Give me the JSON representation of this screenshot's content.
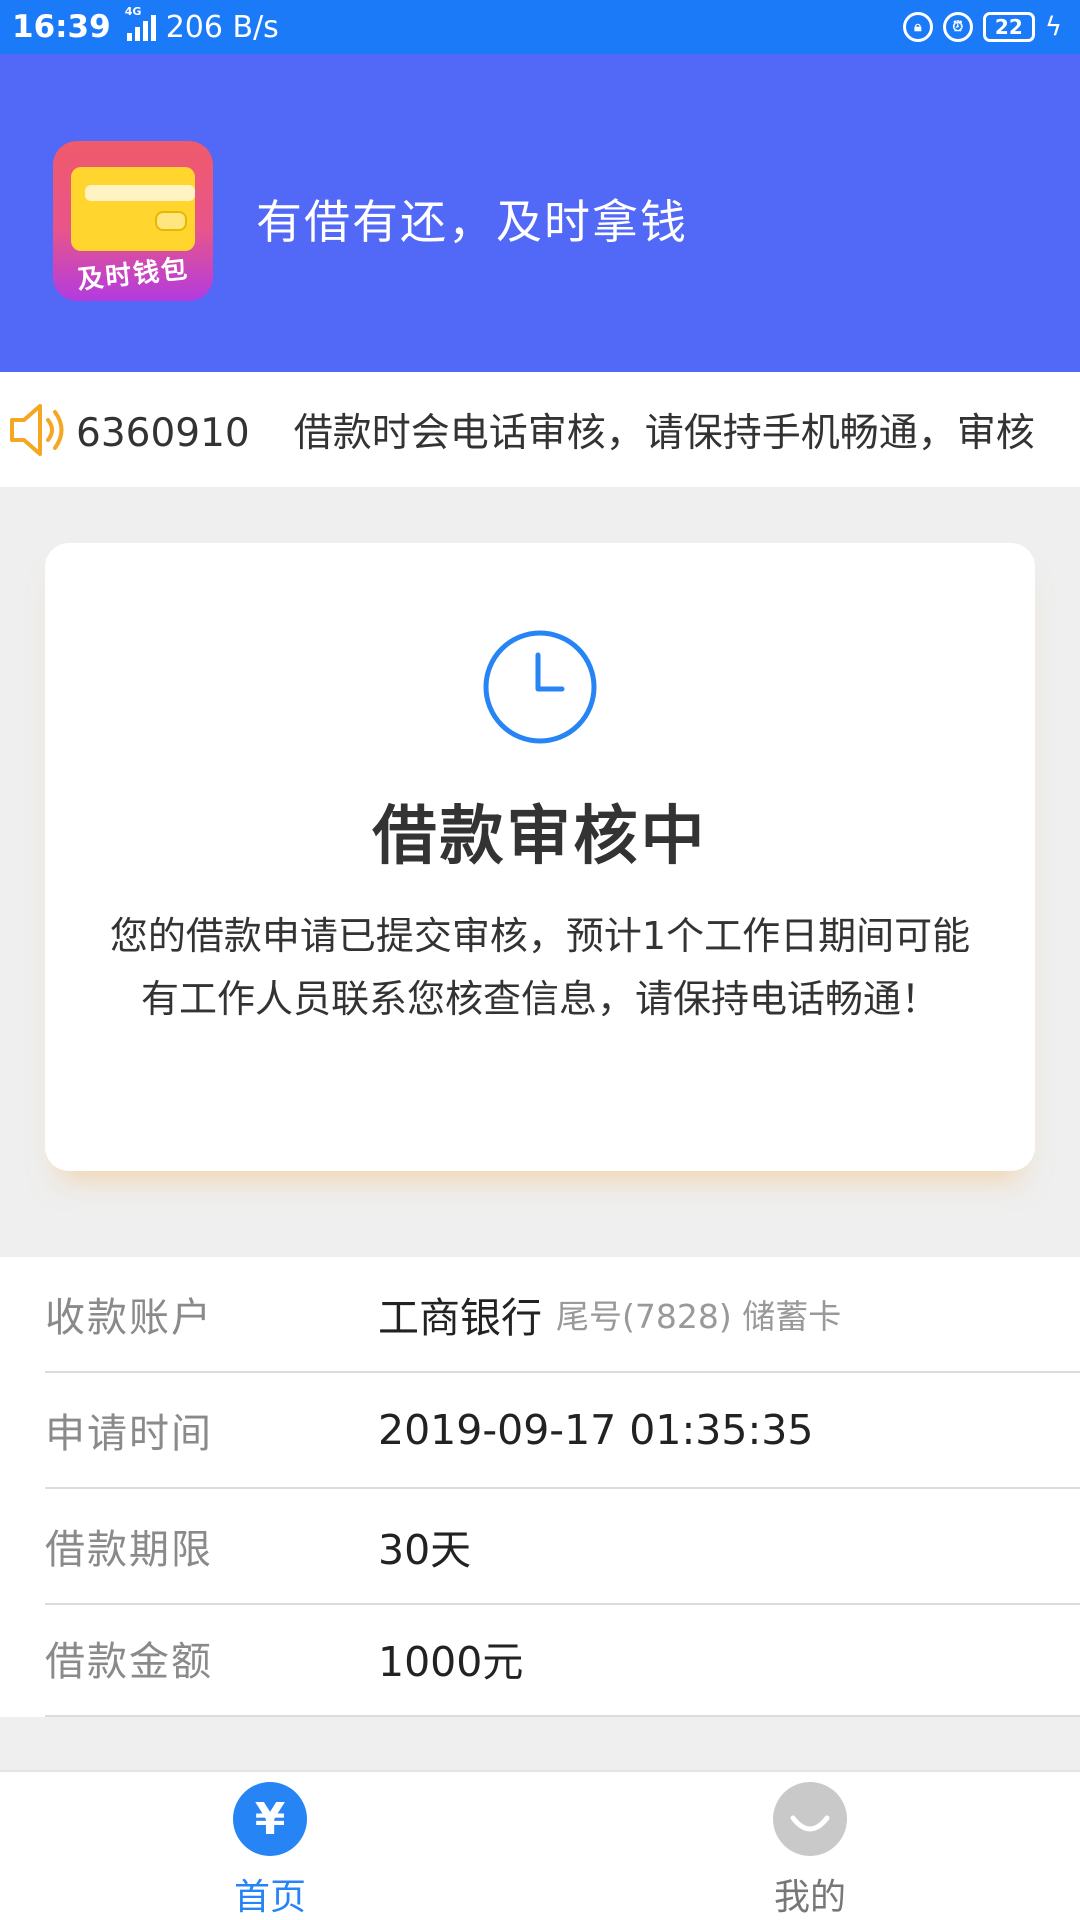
{
  "status_bar": {
    "time": "16:39",
    "network_type": "4G",
    "net_speed": "206 B/s",
    "battery": "22"
  },
  "header": {
    "logo_text": "及时钱包",
    "slogan": "有借有还，及时拿钱"
  },
  "notice": {
    "text_prefix": "6360910",
    "text_main": "借款时会电话审核，请保持手机畅通，审核"
  },
  "status_card": {
    "title": "借款审核中",
    "description": "您的借款申请已提交审核，预计1个工作日期间可能有工作人员联系您核查信息，请保持电话畅通！"
  },
  "info": {
    "account": {
      "label": "收款账户",
      "bank": "工商银行",
      "detail": "尾号(7828) 储蓄卡"
    },
    "apply_time": {
      "label": "申请时间",
      "value": "2019-09-17 01:35:35"
    },
    "term": {
      "label": "借款期限",
      "value": "30天"
    },
    "amount": {
      "label": "借款金额",
      "value": "1000元"
    }
  },
  "tabbar": {
    "home": {
      "label": "首页",
      "icon": "yen-icon",
      "icon_glyph": "¥"
    },
    "mine": {
      "label": "我的",
      "icon": "smile-icon"
    }
  },
  "colors": {
    "status_bar": "#1a7af8",
    "header": "#5268f7",
    "accent_blue": "#2684f5",
    "notice_icon": "#f5a623"
  }
}
